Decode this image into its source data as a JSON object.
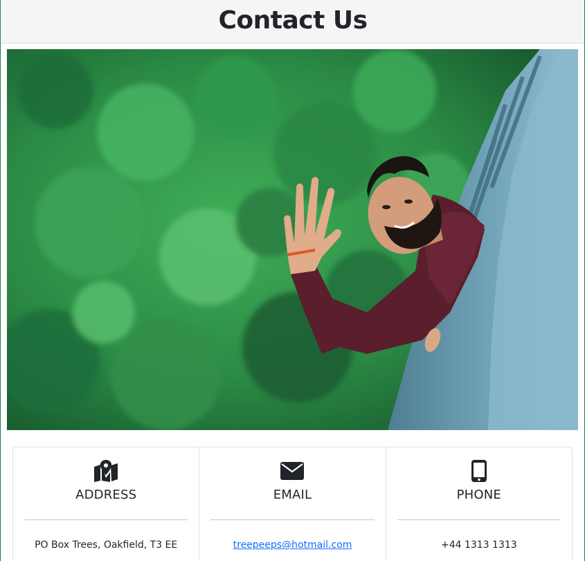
{
  "header": {
    "title": "Contact Us"
  },
  "hero": {
    "image_description_icon": "person-waving-photo"
  },
  "contact": {
    "items": [
      {
        "icon": "map-marker-icon",
        "heading": "ADDRESS",
        "value": "PO Box Trees, Oakfield, T3 EE"
      },
      {
        "icon": "envelope-icon",
        "heading": "EMAIL",
        "value": "treepeeps@hotmail.com"
      },
      {
        "icon": "mobile-phone-icon",
        "heading": "PHONE",
        "value": "+44 1313 1313"
      }
    ]
  },
  "colors": {
    "header_bg": "#f5f5f5",
    "link": "#0d6efd",
    "frame": "#1f7a44"
  }
}
